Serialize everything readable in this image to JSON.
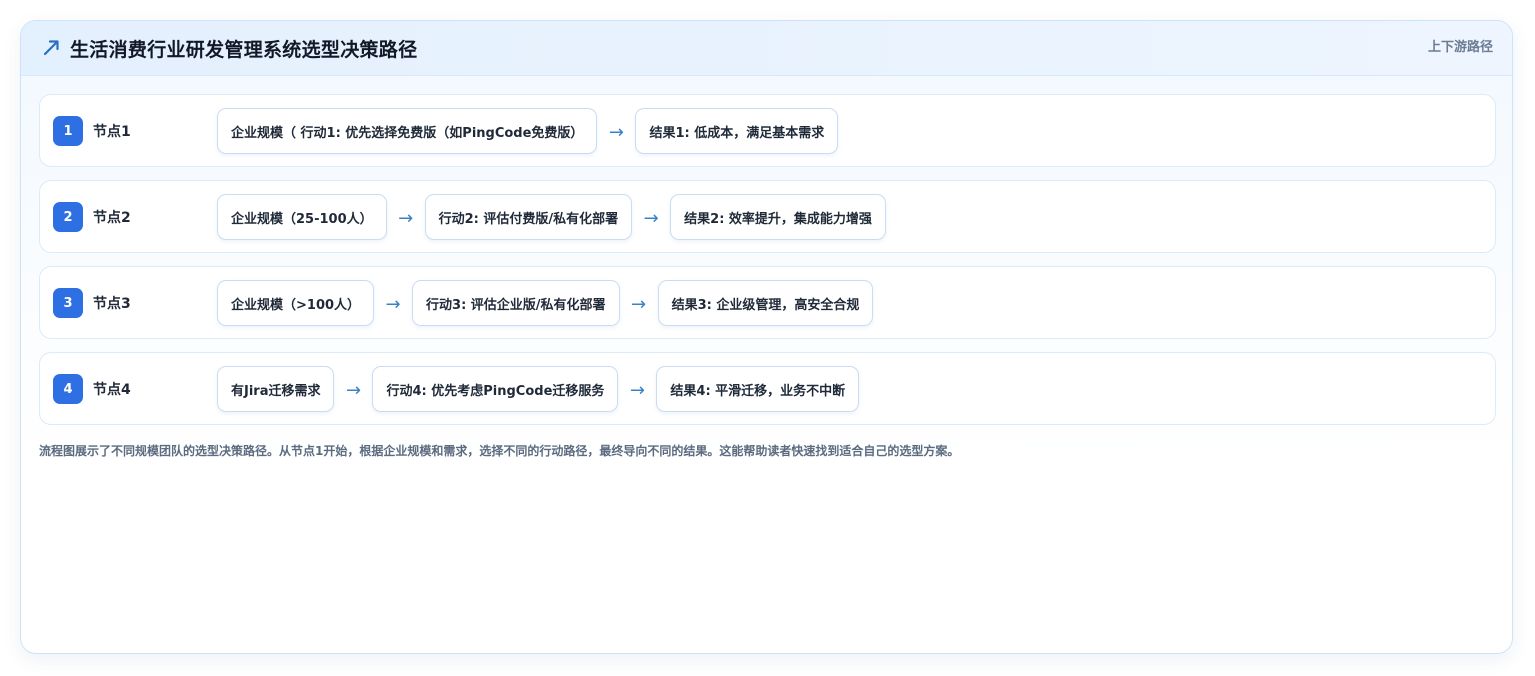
{
  "header": {
    "title": "生活消费行业研发管理系统选型决策路径",
    "icon": "trend-arrow-icon",
    "tag": "上下游路径",
    "accent": "#2f6fe4"
  },
  "rows": [
    {
      "badge": "1",
      "label": "节点1",
      "steps": [
        "企业规模（ 行动1: 优先选择免费版（如PingCode免费版）",
        "结果1: 低成本，满足基本需求"
      ]
    },
    {
      "badge": "2",
      "label": "节点2",
      "steps": [
        "企业规模（25-100人）",
        "行动2: 评估付费版/私有化部署",
        "结果2: 效率提升，集成能力增强"
      ]
    },
    {
      "badge": "3",
      "label": "节点3",
      "steps": [
        "企业规模（>100人）",
        "行动3: 评估企业版/私有化部署",
        "结果3: 企业级管理，高安全合规"
      ]
    },
    {
      "badge": "4",
      "label": "节点4",
      "steps": [
        "有Jira迁移需求",
        "行动4: 优先考虑PingCode迁移服务",
        "结果4: 平滑迁移，业务不中断"
      ]
    }
  ],
  "arrow_glyph": "→",
  "note": "流程图展示了不同规模团队的选型决策路径。从节点1开始，根据企业规模和需求，选择不同的行动路径，最终导向不同的结果。这能帮助读者快速找到适合自己的选型方案。"
}
